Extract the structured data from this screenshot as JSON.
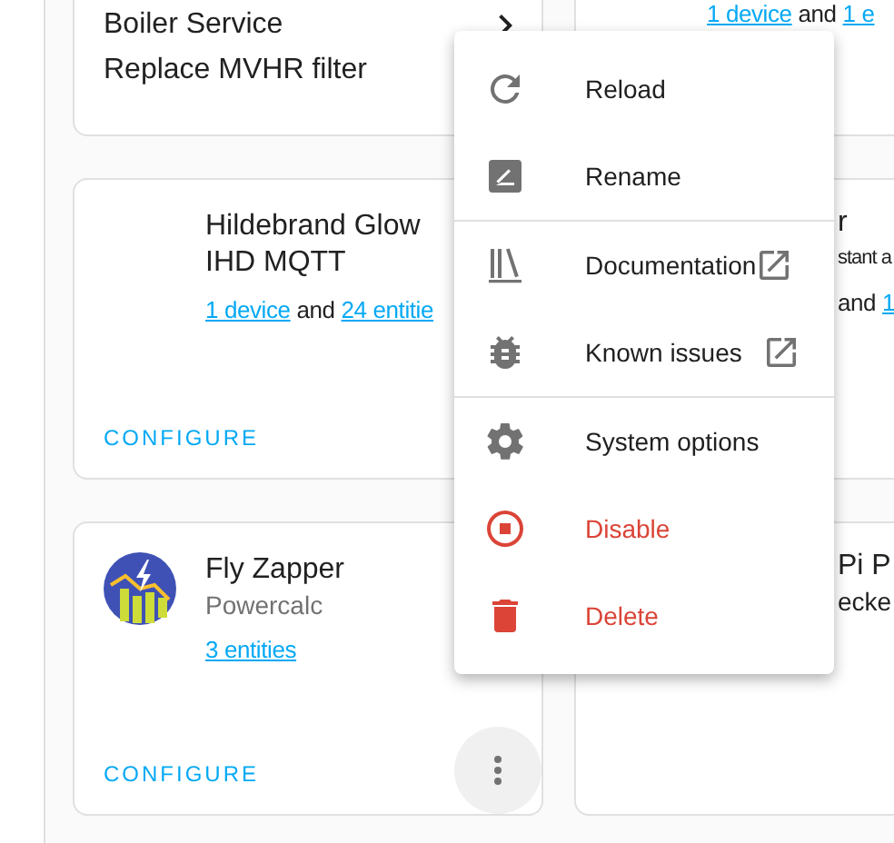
{
  "columns": [
    {
      "cards": [
        {
          "kind": "list",
          "items": [
            {
              "text": "Boiler Service",
              "chevron": true
            },
            {
              "text": "Replace MVHR filter",
              "chevron": false
            }
          ]
        },
        {
          "kind": "plain",
          "title": "Hildebrand Glow IHD MQTT",
          "links": [
            "1 device",
            "24 entitie"
          ],
          "joiner": "and",
          "action": "CONFIGURE"
        },
        {
          "kind": "logo",
          "title": "Fly Zapper",
          "subtitle": "Powercalc",
          "links": [
            "3 entities"
          ],
          "action": "CONFIGURE"
        }
      ]
    },
    {
      "cards": [
        {
          "kind": "links",
          "links": [
            "1 device",
            "1 e"
          ],
          "joiner": "and"
        },
        {
          "kind": "partial",
          "title": "r",
          "subtitle": "stant a",
          "joiner": "and",
          "links": [
            "1"
          ]
        },
        {
          "kind": "partial",
          "title": "Pi P",
          "subtitle": "ecke"
        }
      ]
    }
  ],
  "menu": {
    "items": [
      {
        "kind": "reload",
        "label": "Reload",
        "external": false,
        "danger": false
      },
      {
        "kind": "rename",
        "label": "Rename",
        "external": false,
        "danger": false
      },
      {
        "kind": "divider"
      },
      {
        "kind": "docs",
        "label": "Documentation",
        "external": true,
        "danger": false
      },
      {
        "kind": "issues",
        "label": "Known issues",
        "external": true,
        "danger": false
      },
      {
        "kind": "divider"
      },
      {
        "kind": "options",
        "label": "System options",
        "external": false,
        "danger": false
      },
      {
        "kind": "disable",
        "label": "Disable",
        "external": false,
        "danger": true
      },
      {
        "kind": "delete",
        "label": "Delete",
        "external": false,
        "danger": true
      }
    ]
  }
}
